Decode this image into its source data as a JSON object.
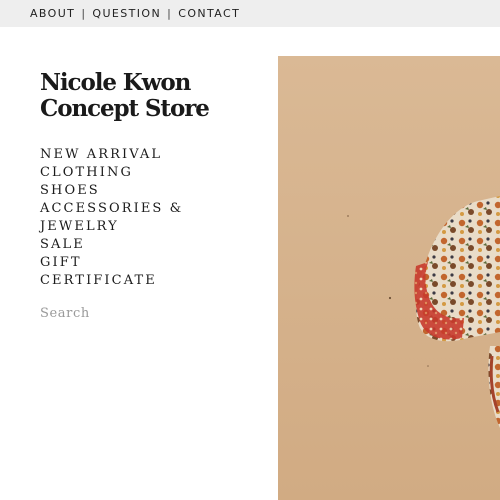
{
  "top_nav": {
    "items": [
      "ABOUT",
      "QUESTION",
      "CONTACT"
    ],
    "separator": "|"
  },
  "brand": {
    "line1": "Nicole Kwon",
    "line2": "Concept Store"
  },
  "menu": {
    "items": [
      "NEW ARRIVAL",
      "CLOTHING",
      "SHOES",
      "ACCESSORIES &",
      "JEWELRY",
      "SALE",
      "GIFT",
      "CERTIFICATE"
    ]
  },
  "search": {
    "placeholder": "Search",
    "value": ""
  },
  "hero": {
    "image": "model-in-floral-kimono-against-beige-wall",
    "wall_color": "#d6b28c"
  }
}
